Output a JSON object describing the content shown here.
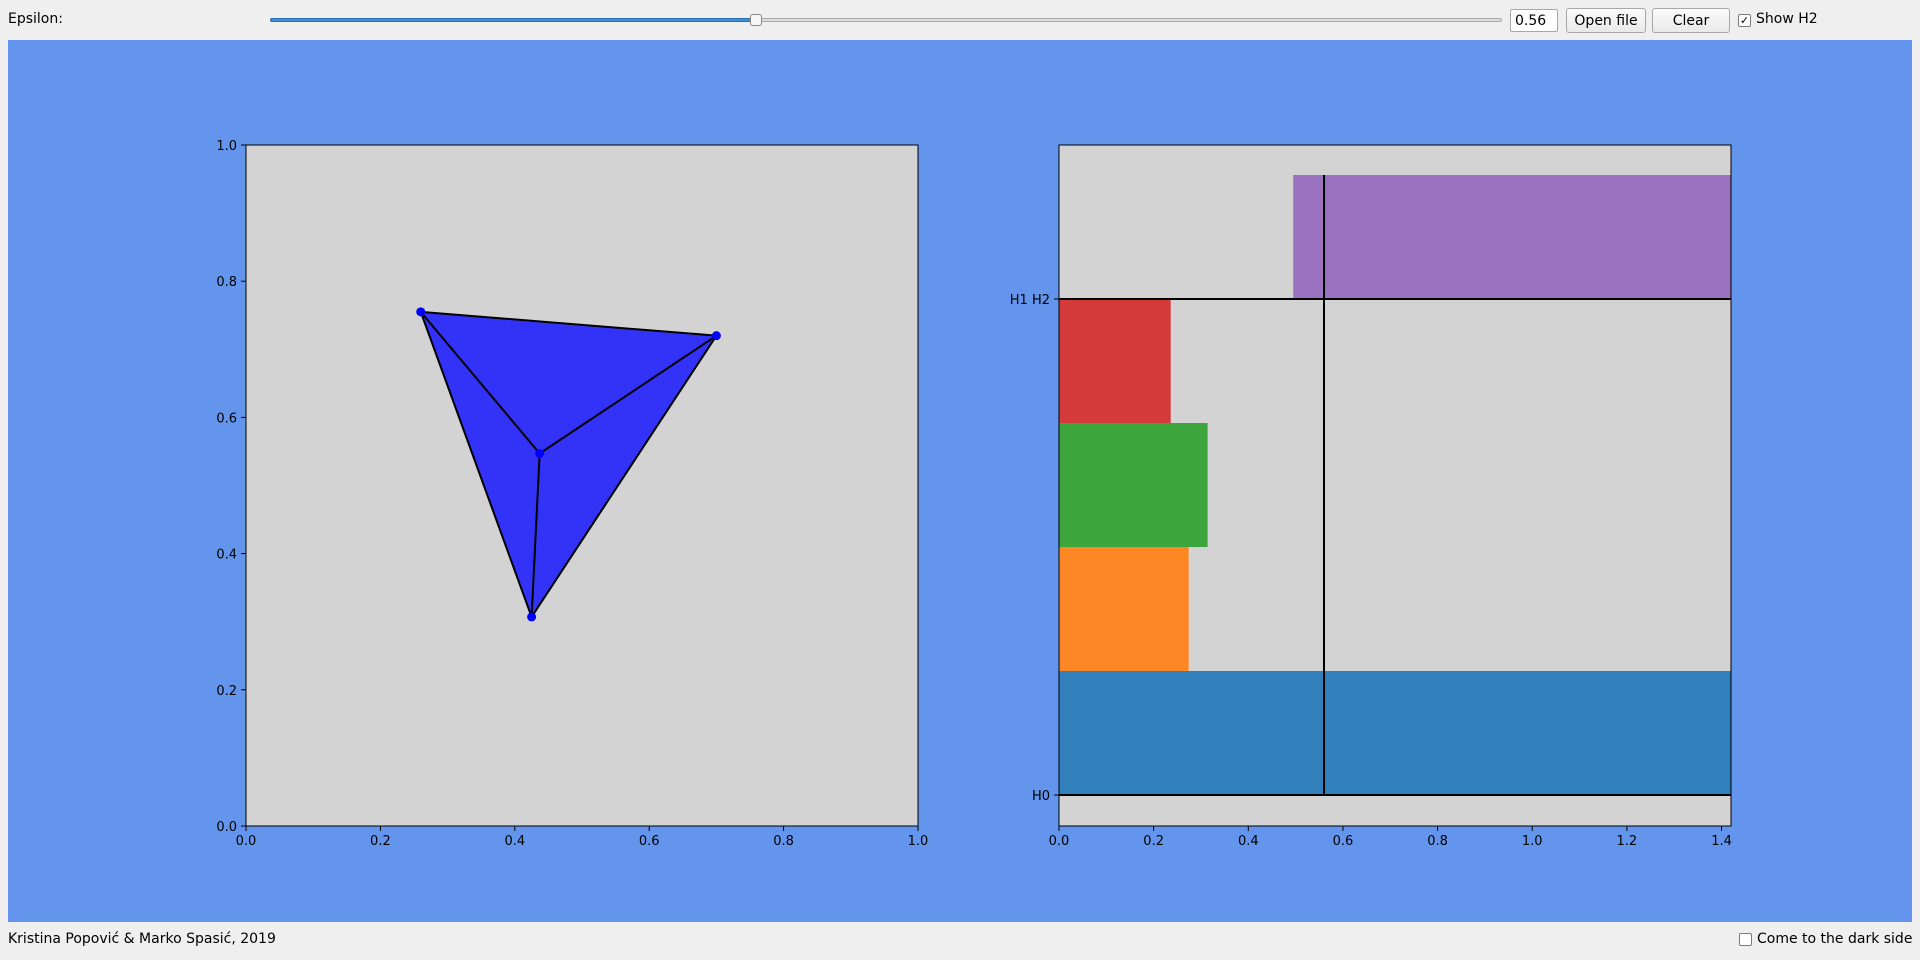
{
  "toolbar": {
    "epsilon_label": "Epsilon:",
    "epsilon_value": "0.56",
    "slider": {
      "min": 0,
      "max": 1.42,
      "value": 0.56
    },
    "open_file_label": "Open file",
    "clear_label": "Clear",
    "show_h2_checked": true,
    "show_h2_label": "Show H2"
  },
  "colors": {
    "canvas_bg": "#6495ed",
    "plot_bg": "#d3d3d3",
    "complex_fill": "#3333f7",
    "point_color": "#0000ff"
  },
  "chart_data": [
    {
      "type": "scatter",
      "xlim": [
        0,
        1
      ],
      "ylim": [
        0,
        1
      ],
      "xticks": [
        "0.0",
        "0.2",
        "0.4",
        "0.6",
        "0.8",
        "1.0"
      ],
      "yticks": [
        "0.0",
        "0.2",
        "0.4",
        "0.6",
        "0.8",
        "1.0"
      ],
      "points": [
        {
          "x": 0.26,
          "y": 0.755
        },
        {
          "x": 0.7,
          "y": 0.72
        },
        {
          "x": 0.437,
          "y": 0.547
        },
        {
          "x": 0.425,
          "y": 0.307
        }
      ],
      "edges": [
        [
          0,
          1
        ],
        [
          0,
          2
        ],
        [
          1,
          2
        ],
        [
          0,
          3
        ],
        [
          1,
          3
        ],
        [
          2,
          3
        ]
      ],
      "triangles": [
        [
          0,
          1,
          3
        ]
      ]
    },
    {
      "type": "bar",
      "orientation": "horizontal",
      "xlim": [
        0,
        1.42
      ],
      "xticks": [
        "0.0",
        "0.2",
        "0.4",
        "0.6",
        "0.8",
        "1.0",
        "1.2",
        "1.4"
      ],
      "group_labels": [
        {
          "label": "H0",
          "y": 0
        },
        {
          "label": "H1 H2",
          "y": 4
        }
      ],
      "epsilon_line": 0.56,
      "bars": [
        {
          "row": 0,
          "start": 0,
          "end": 1.42,
          "color": "#3180bb"
        },
        {
          "row": 1,
          "start": 0,
          "end": 0.274,
          "color": "#fd8724"
        },
        {
          "row": 2,
          "start": 0,
          "end": 0.314,
          "color": "#3ca53c"
        },
        {
          "row": 3,
          "start": 0,
          "end": 0.236,
          "color": "#d43a3a"
        },
        {
          "row": 4,
          "start": 0.495,
          "end": 1.42,
          "color": "#9a72bf"
        }
      ]
    }
  ],
  "footer": {
    "credits": "Kristina Popović & Marko Spasić, 2019",
    "dark_side_checked": false,
    "dark_side_label": "Come to the dark side"
  }
}
